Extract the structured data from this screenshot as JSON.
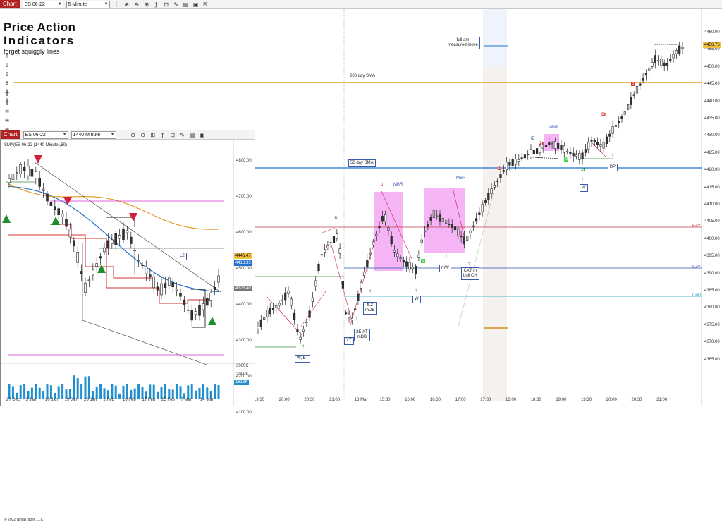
{
  "toolbar": {
    "chart_tag": "Chart",
    "instrument": "ES 06-22",
    "timeframe": "5 Minute",
    "icons": [
      "zoom-icon",
      "zoom-out-icon",
      "search-icon",
      "crosshair-icon",
      "cursor-icon",
      "pan-icon",
      "draw-icon",
      "settings-icon"
    ]
  },
  "heading": {
    "line1": "Price Action",
    "line2": "Indicators",
    "line3": "forget squiggly lines"
  },
  "main_chart": {
    "y_ticks": [
      "4460.00",
      "4455.00",
      "4450.00",
      "4445.00",
      "4440.00",
      "4435.00",
      "4430.00",
      "4425.00",
      "4420.00",
      "4415.00",
      "4410.00",
      "4405.00",
      "4400.00",
      "4395.00",
      "4390.00",
      "4385.00",
      "4380.00",
      "4375.00",
      "4370.00",
      "4365.00"
    ],
    "x_ticks": [
      "19:30",
      "20:00",
      "20:30",
      "21:00",
      "18 Mar",
      "15:30",
      "16:00",
      "16:30",
      "17:00",
      "17:30",
      "18:00",
      "18:30",
      "19:00",
      "19:30",
      "20:00",
      "20:30",
      "21:00"
    ],
    "price_tag": "4456.75",
    "level_labels": {
      "hoy": "HoY",
      "coy": "CoY",
      "ood": "OoD"
    },
    "annotations": {
      "full_am": "full am\nmeasured move",
      "sma200": "200 day SMA",
      "sma50": "50 day SMA",
      "mbr1": "MBR",
      "mbr2": "MBR",
      "mbr3": "MBR",
      "ib1": "IB",
      "ib2": "IB",
      "w_bt": "W, BT",
      "xt": "XT",
      "fl2_mdb": "fL2\nmDB",
      "xt_mdb": "2E XT\nmDB",
      "w1": "W",
      "mw": "mW",
      "cxt": "CXT in\nbull CH",
      "w2": "W",
      "bp": "BP",
      "st": "St",
      "one_t": "1t",
      "two_t": "2t"
    }
  },
  "inset": {
    "chart_tag": "Chart",
    "instrument": "ES 06-22",
    "timeframe": "1440 Minute",
    "legend": "SMA(ES 06-22 (1440 Minute),50)",
    "y_ticks": [
      "4800.00",
      "4700.00",
      "4600.00",
      "4500.00",
      "4400.00",
      "4300.00",
      "4200.00",
      "4100.00"
    ],
    "vol_ticks": [
      "3000K",
      "2000K",
      "1000K"
    ],
    "x_ticks": [
      "27 Dec",
      "3 Jan",
      "10 Jan",
      "19 Jan",
      "26 Jan",
      "2 Feb",
      "10 Feb",
      "17 Feb",
      "25 Feb",
      "7 Mar",
      "14 Mar"
    ],
    "price_tags": {
      "last": "4446.47",
      "sma": "4418.33",
      "low": "4323.40",
      "vol": "1613K"
    },
    "l2_label": "L2",
    "copyright": "© 2022 NinjaTrader, LLC"
  },
  "colors": {
    "sma200": "#e08a00",
    "sma50": "#1f6fd1",
    "hoy": "#c23a4a",
    "coy": "#2f4fb0",
    "ood": "#1ba3c9",
    "mbr_box": "#f08cf0",
    "bull_arrow": "#1a8f2a",
    "bear_arrow": "#d0203a",
    "price_tag": "#f0c040"
  }
}
